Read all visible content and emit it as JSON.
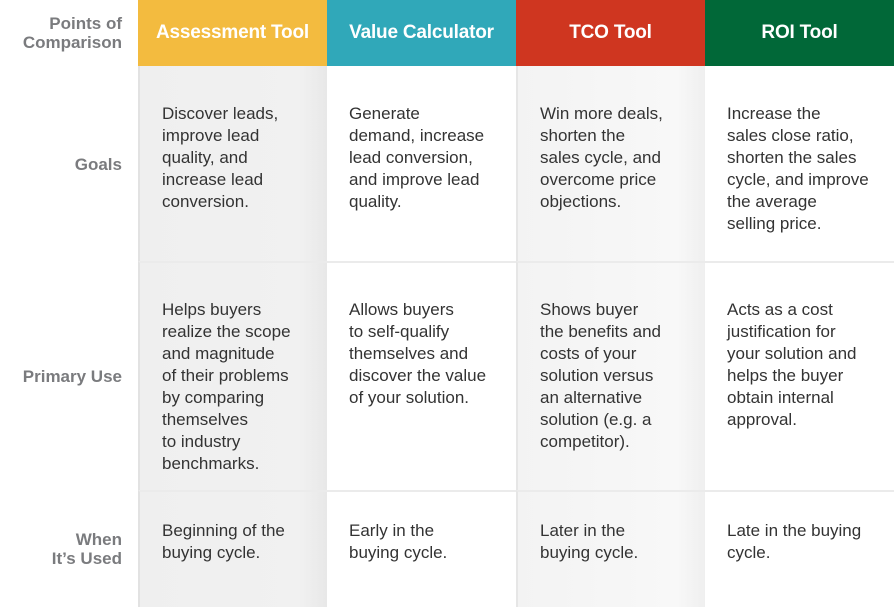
{
  "table": {
    "corner_label": "Points of\nComparison",
    "columns": [
      {
        "label": "Assessment Tool",
        "color": "#f3bb3f"
      },
      {
        "label": "Value Calculator",
        "color": "#30a8b9"
      },
      {
        "label": "TCO Tool",
        "color": "#cf3620"
      },
      {
        "label": "ROI Tool",
        "color": "#016838"
      }
    ],
    "rows": [
      {
        "label": "Goals",
        "cells": [
          "Discover leads,\nimprove lead\nquality, and\nincrease lead\nconversion.",
          "Generate\ndemand, increase\nlead conversion,\nand improve lead\nquality.",
          "Win more deals,\nshorten the\nsales cycle, and\novercome price\nobjections.",
          "Increase the\nsales close ratio,\nshorten the sales\ncycle, and improve\nthe average\nselling price."
        ]
      },
      {
        "label": "Primary Use",
        "cells": [
          "Helps buyers\nrealize the scope\nand magnitude\nof their problems\nby comparing\nthemselves\nto industry\nbenchmarks.",
          "Allows buyers\nto self-qualify\nthemselves and\ndiscover the value\nof your solution.",
          "Shows buyer\nthe benefits and\ncosts of your\nsolution versus\nan alternative\nsolution (e.g. a\ncompetitor).",
          "Acts as a cost\njustification for\nyour solution and\nhelps the buyer\nobtain internal\napproval."
        ]
      },
      {
        "label": "When\nIt’s Used",
        "cells": [
          "Beginning of the\nbuying cycle.",
          "Early in the\nbuying cycle.",
          "Later in the\nbuying cycle.",
          "Late in the buying\ncycle."
        ]
      }
    ]
  }
}
